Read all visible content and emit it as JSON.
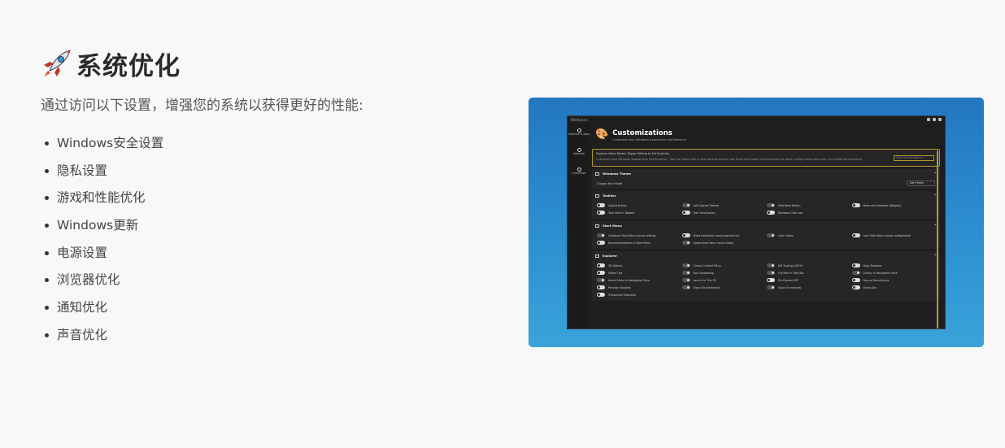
{
  "section": {
    "title": "系统优化",
    "subtitle": "通过访问以下设置，增强您的系统以获得更好的性能:",
    "features": [
      "Windows安全设置",
      "隐私设置",
      "游戏和性能优化",
      "Windows更新",
      "电源设置",
      "浏览器优化",
      "通知优化",
      "声音优化"
    ]
  },
  "screenshot": {
    "app_name": "WinHance",
    "sidebar": [
      "Software & Apps",
      "Optimize",
      "Customize"
    ],
    "page_title": "Customizations",
    "page_subtitle": "Customize Your Windows Experience and Behavior",
    "notice_line1": "Explorer Value Modes, Toggle Setting to Set Explicitly",
    "notice_line2": "Customize Your Windows Appearance and Behavior - Use the Search bar to find settings quickly. Use Show and Import Configurations to share configurations and copy your preferred selections.",
    "search_placeholder": "Type here to search...",
    "theme_panel": {
      "title": "Windows Theme",
      "label": "Choose Your Mode",
      "value": "Dark Mode"
    },
    "panels": [
      {
        "title": "Taskbar",
        "rows": [
          [
            {
              "label": "Copilot Button",
              "on": true
            },
            {
              "label": "Left Aligned Taskbar",
              "on": false
            },
            {
              "label": "Meet Now Button",
              "on": false
            },
            {
              "label": "News and Interests (Widgets)",
              "on": true
            }
          ],
          [
            {
              "label": "Task View in Taskbar",
              "on": true
            },
            {
              "label": "Task View Button",
              "on": true
            },
            {
              "label": "Windows Chat Icon",
              "on": true
            }
          ]
        ]
      },
      {
        "title": "Start Menu",
        "rows": [
          [
            {
              "label": "Configure Start Menu layout settings",
              "on": false
            },
            {
              "label": "Show frequently used programs list",
              "on": true
            },
            {
              "label": "Lock Option",
              "on": false
            },
            {
              "label": "Lock Start Menu layout configuration",
              "on": true
            }
          ],
          [
            {
              "label": "Recommendations in Start Menu",
              "on": true
            },
            {
              "label": "Speed Start Menu layout Setup",
              "on": false
            }
          ]
        ]
      },
      {
        "title": "Explorer",
        "rows": [
          [
            {
              "label": "3D Objects",
              "on": true
            },
            {
              "label": "Classic Context Menu",
              "on": false
            },
            {
              "label": "DPI Scaling (100%)",
              "on": false
            },
            {
              "label": "Drop Shadows",
              "on": true
            }
          ],
          [
            {
              "label": "Folder Tips",
              "on": true
            },
            {
              "label": "Font Smoothing",
              "on": false
            },
            {
              "label": "Full Path in Title Bar",
              "on": false
            },
            {
              "label": "Gallery in Navigation Pane",
              "on": false
            }
          ],
          [
            {
              "label": "Home Folder in Navigation Pane",
              "on": false
            },
            {
              "label": "Launch to This PC",
              "on": false
            },
            {
              "label": "Per-Process DPI",
              "on": true
            },
            {
              "label": "Pop-up Descriptions",
              "on": true
            }
          ],
          [
            {
              "label": "Preview Handlers",
              "on": true
            },
            {
              "label": "Show File Extensions",
              "on": false
            },
            {
              "label": "Show Thumbnails",
              "on": false
            },
            {
              "label": "Status Bar",
              "on": true
            }
          ],
          [
            {
              "label": "Translucent Selection",
              "on": true
            }
          ]
        ]
      }
    ]
  }
}
